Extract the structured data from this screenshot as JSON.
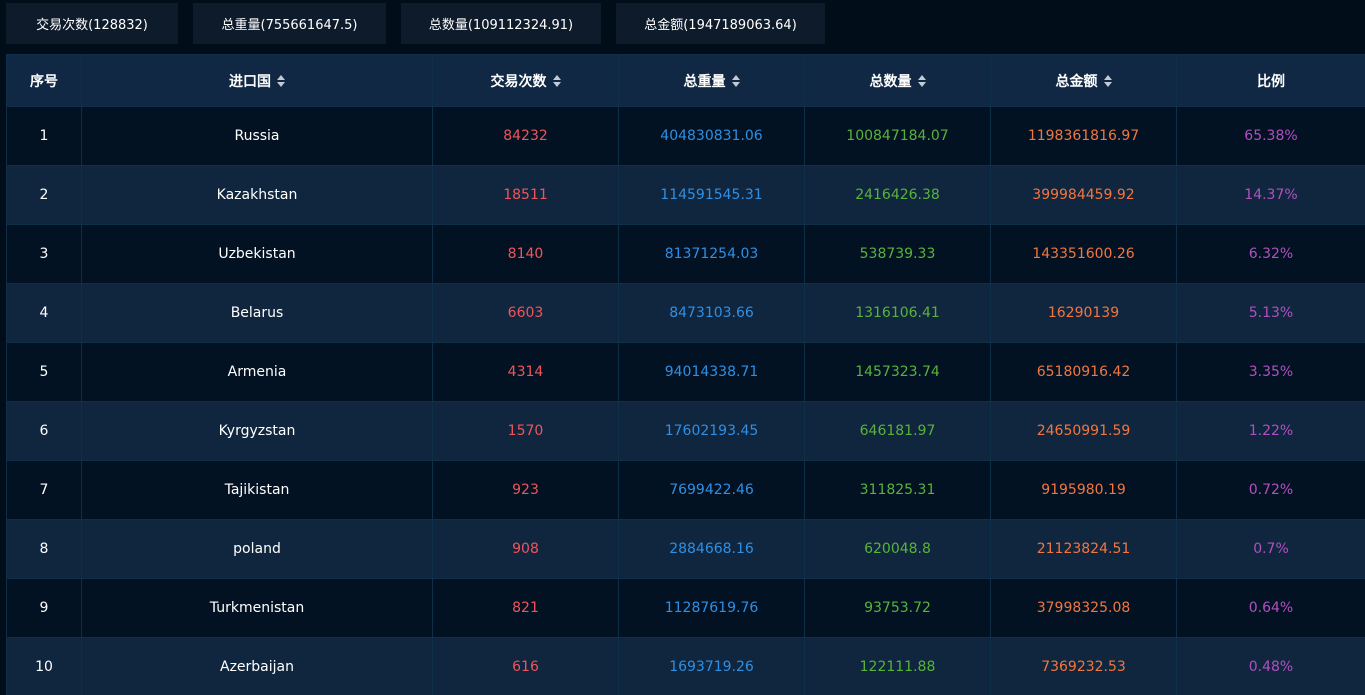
{
  "summary": {
    "trade_count": "交易次数(128832)",
    "total_weight": "总重量(755661647.5)",
    "total_quantity": "总数量(109112324.91)",
    "total_amount": "总金额(1947189063.64)"
  },
  "table": {
    "headers": {
      "index": "序号",
      "country": "进口国",
      "count": "交易次数",
      "weight": "总重量",
      "quantity": "总数量",
      "amount": "总金额",
      "ratio": "比例"
    },
    "rows": [
      {
        "index": "1",
        "country": "Russia",
        "count": "84232",
        "weight": "404830831.06",
        "quantity": "100847184.07",
        "amount": "1198361816.97",
        "ratio": "65.38%"
      },
      {
        "index": "2",
        "country": "Kazakhstan",
        "count": "18511",
        "weight": "114591545.31",
        "quantity": "2416426.38",
        "amount": "399984459.92",
        "ratio": "14.37%"
      },
      {
        "index": "3",
        "country": "Uzbekistan",
        "count": "8140",
        "weight": "81371254.03",
        "quantity": "538739.33",
        "amount": "143351600.26",
        "ratio": "6.32%"
      },
      {
        "index": "4",
        "country": "Belarus",
        "count": "6603",
        "weight": "8473103.66",
        "quantity": "1316106.41",
        "amount": "16290139",
        "ratio": "5.13%"
      },
      {
        "index": "5",
        "country": "Armenia",
        "count": "4314",
        "weight": "94014338.71",
        "quantity": "1457323.74",
        "amount": "65180916.42",
        "ratio": "3.35%"
      },
      {
        "index": "6",
        "country": "Kyrgyzstan",
        "count": "1570",
        "weight": "17602193.45",
        "quantity": "646181.97",
        "amount": "24650991.59",
        "ratio": "1.22%"
      },
      {
        "index": "7",
        "country": "Tajikistan",
        "count": "923",
        "weight": "7699422.46",
        "quantity": "311825.31",
        "amount": "9195980.19",
        "ratio": "0.72%"
      },
      {
        "index": "8",
        "country": "poland",
        "count": "908",
        "weight": "2884668.16",
        "quantity": "620048.8",
        "amount": "21123824.51",
        "ratio": "0.7%"
      },
      {
        "index": "9",
        "country": "Turkmenistan",
        "count": "821",
        "weight": "11287619.76",
        "quantity": "93753.72",
        "amount": "37998325.08",
        "ratio": "0.64%"
      },
      {
        "index": "10",
        "country": "Azerbaijan",
        "count": "616",
        "weight": "1693719.26",
        "quantity": "122111.88",
        "amount": "7369232.53",
        "ratio": "0.48%"
      }
    ]
  },
  "icons": {
    "sort": "sort-icon"
  },
  "colors": {
    "count": "#f0545b",
    "weight": "#2f8fe3",
    "quantity": "#58b33a",
    "amount": "#f2763f",
    "ratio": "#b24fc0"
  }
}
